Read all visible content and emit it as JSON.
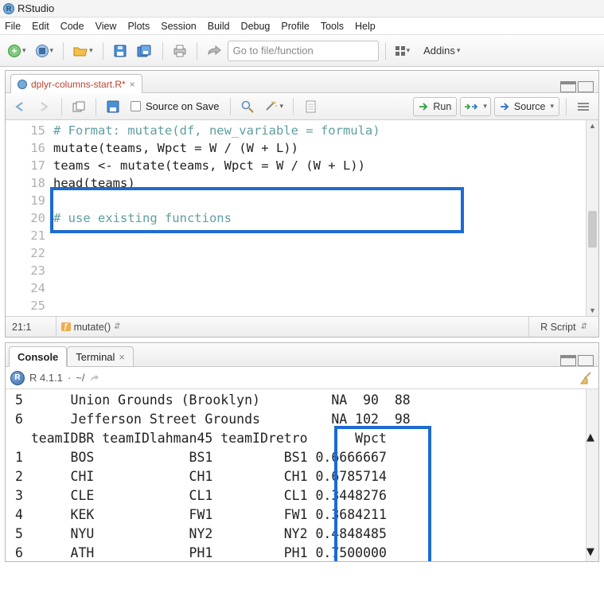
{
  "app": {
    "title": "RStudio"
  },
  "menu": [
    "File",
    "Edit",
    "Code",
    "View",
    "Plots",
    "Session",
    "Build",
    "Debug",
    "Profile",
    "Tools",
    "Help"
  ],
  "toolbar": {
    "goto_placeholder": "Go to file/function",
    "addins_label": "Addins"
  },
  "source": {
    "filename": "dplyr-columns-start.R*",
    "toolbar": {
      "source_on_save": "Source on Save",
      "run": "Run",
      "source": "Source"
    },
    "status": {
      "cursor": "21:1",
      "scope": "mutate()",
      "lang": "R Script"
    },
    "lines": [
      {
        "n": 15,
        "type": "comment",
        "text": "# Format: mutate(df, new_variable = formula)"
      },
      {
        "n": 16,
        "type": "code",
        "text": ""
      },
      {
        "n": 17,
        "type": "code",
        "text": "mutate(teams, Wpct = W / (W + L))"
      },
      {
        "n": 18,
        "type": "code",
        "text": ""
      },
      {
        "n": 19,
        "type": "code",
        "text": "teams <- mutate(teams, Wpct = W / (W + L))"
      },
      {
        "n": 20,
        "type": "code",
        "text": "head(teams)"
      },
      {
        "n": 21,
        "type": "code",
        "text": ""
      },
      {
        "n": 22,
        "type": "code",
        "text": ""
      },
      {
        "n": 23,
        "type": "comment",
        "text": "# use existing functions"
      },
      {
        "n": 24,
        "type": "code",
        "text": ""
      },
      {
        "n": 25,
        "type": "code",
        "text": ""
      }
    ],
    "highlight": {
      "from_line": 19,
      "to_line": 20
    }
  },
  "console": {
    "tabs": {
      "console": "Console",
      "terminal": "Terminal"
    },
    "version": "R 4.1.1",
    "wd": "~/",
    "output_pre": [
      "5      Union Grounds (Brooklyn)         NA  90  88",
      "6      Jefferson Street Grounds         NA 102  98"
    ],
    "header_line": "  teamIDBR teamIDlahman45 teamIDretro      Wpct",
    "rows": [
      {
        "idx": "1",
        "br": "BOS",
        "l45": "BS1",
        "retro": "BS1",
        "wpct": "0.6666667"
      },
      {
        "idx": "2",
        "br": "CHI",
        "l45": "CH1",
        "retro": "CH1",
        "wpct": "0.6785714"
      },
      {
        "idx": "3",
        "br": "CLE",
        "l45": "CL1",
        "retro": "CL1",
        "wpct": "0.3448276"
      },
      {
        "idx": "4",
        "br": "KEK",
        "l45": "FW1",
        "retro": "FW1",
        "wpct": "0.3684211"
      },
      {
        "idx": "5",
        "br": "NYU",
        "l45": "NY2",
        "retro": "NY2",
        "wpct": "0.4848485"
      },
      {
        "idx": "6",
        "br": "ATH",
        "l45": "PH1",
        "retro": "PH1",
        "wpct": "0.7500000"
      }
    ],
    "prompt": ">"
  }
}
